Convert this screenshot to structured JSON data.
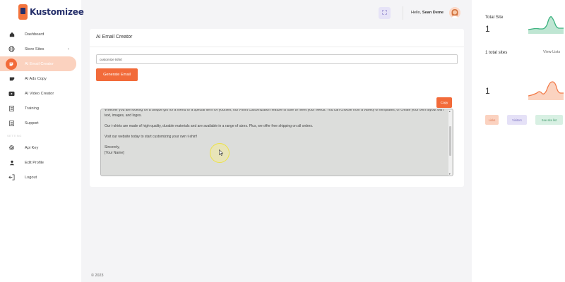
{
  "app": {
    "logo_text": "Kustomizee"
  },
  "sidebar": {
    "items": [
      {
        "label": "Dashboard",
        "icon": "home-icon"
      },
      {
        "label": "Store Sites",
        "icon": "globe-icon",
        "chevron": "›"
      },
      {
        "label": "AI Email Creator",
        "icon": "email-creator-icon",
        "active": true
      },
      {
        "label": "AI Ads Copy",
        "icon": "ads-copy-icon"
      },
      {
        "label": "AI Video Creator",
        "icon": "video-icon"
      },
      {
        "label": "Training",
        "icon": "document-icon"
      },
      {
        "label": "Support",
        "icon": "document-icon"
      }
    ],
    "section_label": "SETTING",
    "settings_items": [
      {
        "label": "Api Key",
        "icon": "gear-icon"
      },
      {
        "label": "Edit Profile",
        "icon": "user-icon"
      },
      {
        "label": "Logout",
        "icon": "logout-icon"
      }
    ]
  },
  "header": {
    "greeting_prefix": "Hello,",
    "user_name": "Sean Deme",
    "expand_icon": "fullscreen-icon"
  },
  "main": {
    "card_title": "AI Email Creator",
    "prompt_value": "customize tshirt",
    "generate_label": "Generate Email",
    "copy_label": "Copy",
    "email_paragraphs": [
      "Whether you are looking for a unique gift for a friend or a special item for yourself, our t-shirt customization feature is sure to meet your needs. You can choose from a variety of templates, or create your own layout with text, images, and logos.",
      "Our t-shirts are made of high-quality, durable materials and are available in a range of sizes. Plus, we offer free shipping on all orders.",
      "Visit our website today to start customizing your own t-shirt!"
    ],
    "email_signoff": "Sincerely,",
    "email_name": "[Your Name]",
    "email_scroll_fraction": 0.45
  },
  "footer": {
    "copyright": "© 2023"
  },
  "right_panel": {
    "total_site_label": "Total Site",
    "total_site_value": "1",
    "total_sites_text": "1 total sites",
    "view_lists_label": "View Lists",
    "second_value": "1",
    "pills": [
      {
        "label": "Links",
        "color": "#fbd2c0",
        "text_color": "#e07a55"
      },
      {
        "label": "Visitors",
        "color": "#e5e1f7",
        "text_color": "#7a6fc2"
      },
      {
        "label": "See site list",
        "color": "#d8f0e3",
        "text_color": "#3f9a6a"
      }
    ]
  },
  "colors": {
    "accent": "#f26b3a",
    "brand_navy": "#26306b",
    "spark_green": "#3bb27f",
    "spark_orange": "#f27a48"
  }
}
